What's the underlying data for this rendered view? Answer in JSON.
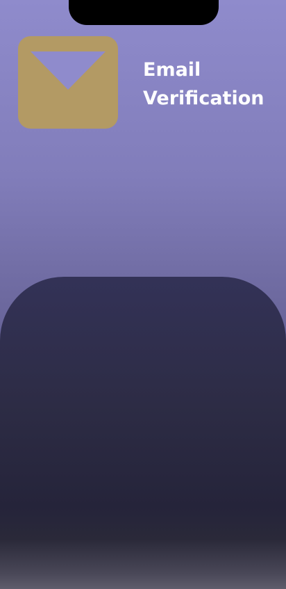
{
  "header": {
    "title_line1": "Email",
    "title_line2": "Verification"
  },
  "icons": {
    "envelope": "envelope-icon"
  },
  "colors": {
    "background_top": "#8f8bcc",
    "panel": "#2d2c45",
    "envelope": "#b39a64",
    "title_text": "#ffffff"
  }
}
